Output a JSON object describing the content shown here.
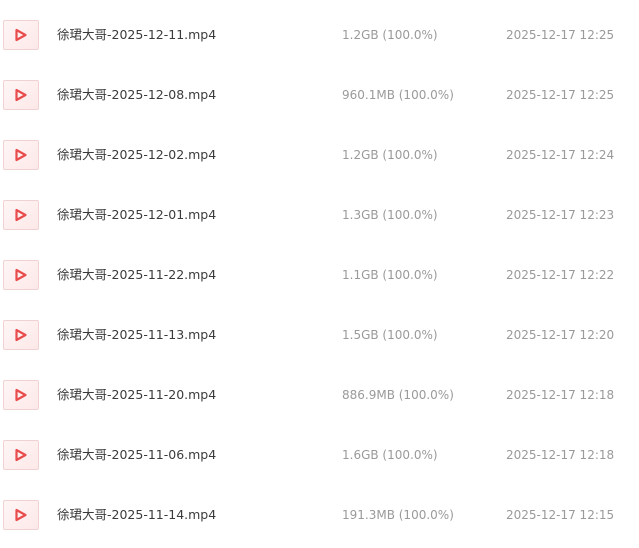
{
  "colors": {
    "accent": "#e84c4c",
    "thumb_bg": "#fde8e8",
    "thumb_border": "#f1d2d2",
    "name_text": "#3b3b3b",
    "meta_text": "#9a9a9a"
  },
  "files": [
    {
      "icon": "video-play-icon",
      "name": "徐珺大哥-2025-12-11.mp4",
      "size": "1.2GB (100.0%)",
      "time": "2025-12-17 12:25"
    },
    {
      "icon": "video-play-icon",
      "name": "徐珺大哥-2025-12-08.mp4",
      "size": "960.1MB (100.0%)",
      "time": "2025-12-17 12:25"
    },
    {
      "icon": "video-play-icon",
      "name": "徐珺大哥-2025-12-02.mp4",
      "size": "1.2GB (100.0%)",
      "time": "2025-12-17 12:24"
    },
    {
      "icon": "video-play-icon",
      "name": "徐珺大哥-2025-12-01.mp4",
      "size": "1.3GB (100.0%)",
      "time": "2025-12-17 12:23"
    },
    {
      "icon": "video-play-icon",
      "name": "徐珺大哥-2025-11-22.mp4",
      "size": "1.1GB (100.0%)",
      "time": "2025-12-17 12:22"
    },
    {
      "icon": "video-play-icon",
      "name": "徐珺大哥-2025-11-13.mp4",
      "size": "1.5GB (100.0%)",
      "time": "2025-12-17 12:20"
    },
    {
      "icon": "video-play-icon",
      "name": "徐珺大哥-2025-11-20.mp4",
      "size": "886.9MB (100.0%)",
      "time": "2025-12-17 12:18"
    },
    {
      "icon": "video-play-icon",
      "name": "徐珺大哥-2025-11-06.mp4",
      "size": "1.6GB (100.0%)",
      "time": "2025-12-17 12:18"
    },
    {
      "icon": "video-play-icon",
      "name": "徐珺大哥-2025-11-14.mp4",
      "size": "191.3MB (100.0%)",
      "time": "2025-12-17 12:15"
    }
  ]
}
